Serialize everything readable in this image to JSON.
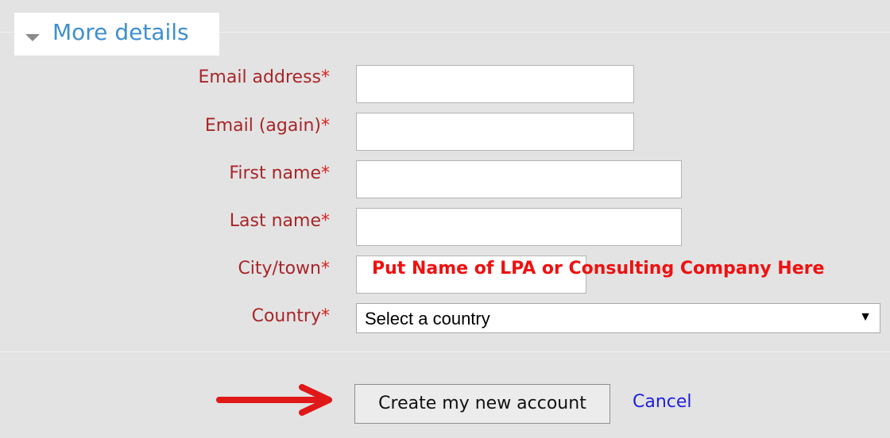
{
  "section": {
    "title": "More details"
  },
  "fields": [
    {
      "label": "Email address",
      "required": "*"
    },
    {
      "label": "Email (again)",
      "required": "*"
    },
    {
      "label": "First name",
      "required": "*"
    },
    {
      "label": "Last name",
      "required": "*"
    },
    {
      "label": "City/town",
      "required": "*"
    },
    {
      "label": "Country",
      "required": "*"
    }
  ],
  "annotation": {
    "city_note": "Put Name of LPA or Consulting Company Here"
  },
  "country": {
    "selected": "Select a country"
  },
  "actions": {
    "create_label": "Create my new account",
    "cancel_label": "Cancel"
  },
  "colors": {
    "label": "#a8262a",
    "link": "#1f1fdd",
    "title": "#3f8fcf",
    "annotation": "#e11111"
  }
}
